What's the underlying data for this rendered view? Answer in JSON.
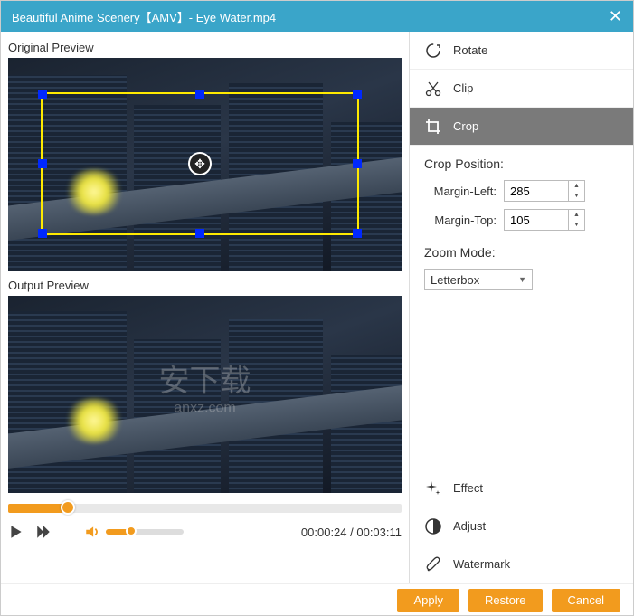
{
  "window": {
    "title": "Beautiful Anime Scenery【AMV】- Eye Water.mp4"
  },
  "left": {
    "original_label": "Original Preview",
    "output_label": "Output Preview",
    "time_current": "00:00:24",
    "time_total": "00:03:11"
  },
  "tools": {
    "rotate": "Rotate",
    "clip": "Clip",
    "crop": "Crop",
    "effect": "Effect",
    "adjust": "Adjust",
    "watermark": "Watermark"
  },
  "crop": {
    "heading": "Crop Position:",
    "margin_left_label": "Margin-Left:",
    "margin_left_value": "285",
    "margin_top_label": "Margin-Top:",
    "margin_top_value": "105"
  },
  "zoom": {
    "heading": "Zoom Mode:",
    "selected": "Letterbox"
  },
  "footer": {
    "apply": "Apply",
    "restore": "Restore",
    "cancel": "Cancel"
  },
  "watermark_text": {
    "main": "安下载",
    "sub": "anxz.com"
  }
}
